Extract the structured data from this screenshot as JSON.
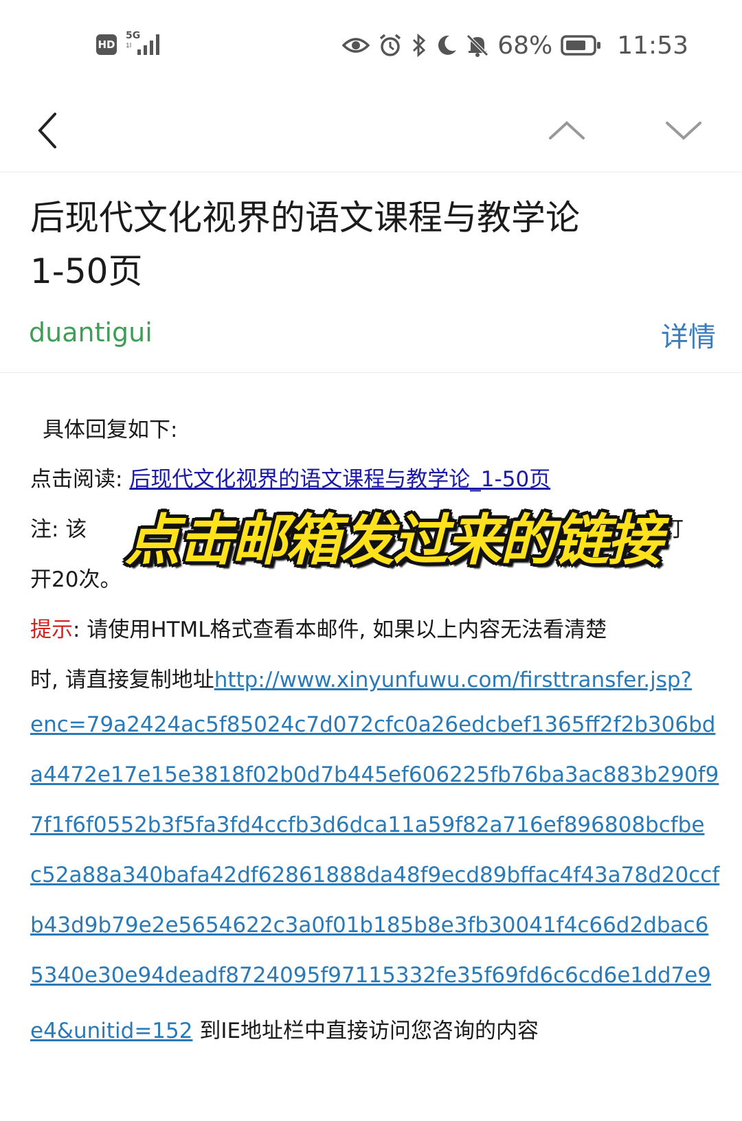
{
  "status_bar": {
    "hd": "HD",
    "network": "5G",
    "network_sub": "1l",
    "battery": "68%",
    "time": "11:53",
    "icons": [
      "eye-icon",
      "alarm-icon",
      "bluetooth-icon",
      "moon-icon",
      "bell-off-icon",
      "battery-icon"
    ]
  },
  "nav": {
    "back_icon": "chevron-left-icon",
    "prev_icon": "chevron-up-icon",
    "next_icon": "chevron-down-icon"
  },
  "mail": {
    "subject_line1": "后现代文化视界的语文课程与教学论",
    "subject_line2": "1-50页",
    "sender": "duantigui",
    "details_label": "详情"
  },
  "body": {
    "intro": "具体回复如下:",
    "read_label": "点击阅读: ",
    "read_link": "后现代文化视界的语文课程与教学论_1-50页",
    "note_start": "注: 该",
    "note_end": "订",
    "note_line2": "开20次。",
    "hint_label": "提示",
    "hint_text": ": 请使用HTML格式查看本邮件, 如果以上内容无法看清楚",
    "hint_line2_prefix": "时, 请直接复制地址",
    "url_parts": [
      "http://www.xinyunfuwu.com/firsttransfer.jsp?",
      "enc=79a2424ac5f85024c7d072cfc0a26edcbef1365ff2f2b306bd",
      "a4472e17e15e3818f02b0d7b445ef606225fb76ba3ac883b290f9",
      "7f1f6f0552b3f5fa3fd4ccfb3d6dca11a59f82a716ef896808bcfbe",
      "c52a88a340bafa42df62861888da48f9ecd89bffac4f43a78d20ccf",
      "b43d9b79e2e5654622c3a0f01b185b8e3fb30041f4c66d2dbac6",
      "5340e30e94deadf8724095f97115332fe35f69fd6c6cd6e1dd7e9",
      "e4&unitid=152"
    ],
    "tail_text": " 到IE地址栏中直接访问您咨询的内容"
  },
  "overlay_caption": "点击邮箱发过来的链接"
}
